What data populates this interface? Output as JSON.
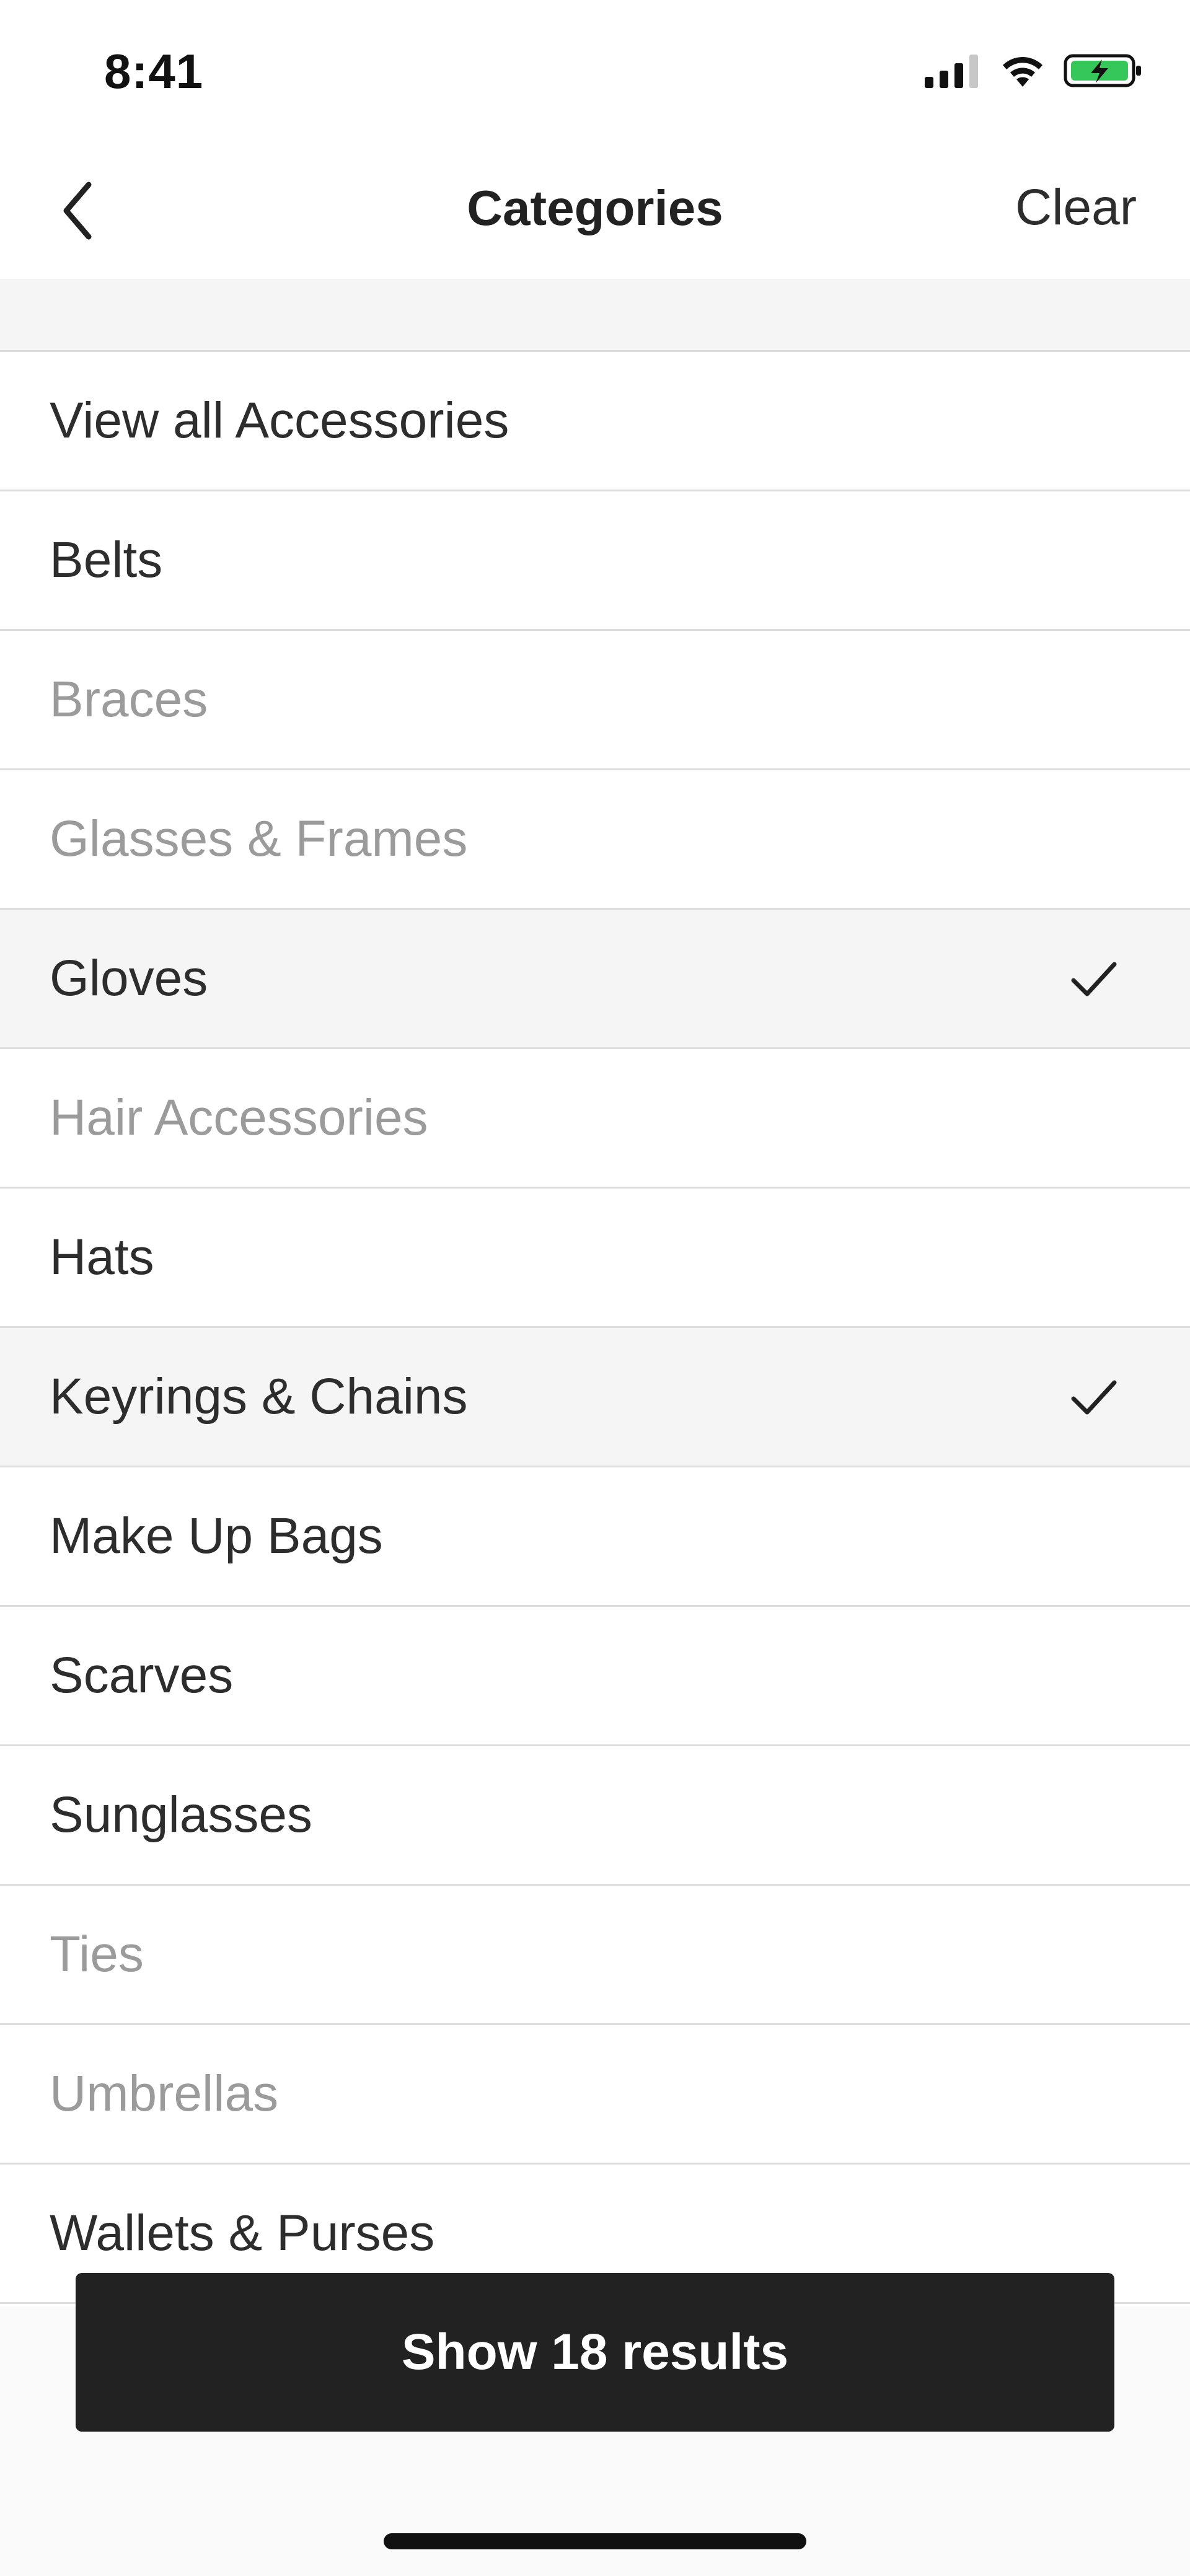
{
  "status_bar": {
    "time": "8:41",
    "icons": [
      "cellular-signal-icon",
      "wifi-icon",
      "battery-charging-icon"
    ],
    "battery_color": "#35c759"
  },
  "nav": {
    "back_icon": "chevron-left-icon",
    "title": "Categories",
    "clear_label": "Clear"
  },
  "categories": [
    {
      "label": "View all Accessories",
      "state": "normal"
    },
    {
      "label": "Belts",
      "state": "normal"
    },
    {
      "label": "Braces",
      "state": "disabled"
    },
    {
      "label": "Glasses & Frames",
      "state": "disabled"
    },
    {
      "label": "Gloves",
      "state": "selected"
    },
    {
      "label": "Hair Accessories",
      "state": "disabled"
    },
    {
      "label": "Hats",
      "state": "normal"
    },
    {
      "label": "Keyrings & Chains",
      "state": "selected"
    },
    {
      "label": "Make Up Bags",
      "state": "normal"
    },
    {
      "label": "Scarves",
      "state": "normal"
    },
    {
      "label": "Sunglasses",
      "state": "normal"
    },
    {
      "label": "Ties",
      "state": "disabled"
    },
    {
      "label": "Umbrellas",
      "state": "disabled"
    },
    {
      "label": "Wallets & Purses",
      "state": "normal"
    }
  ],
  "footer": {
    "show_results_label": "Show 18 results"
  },
  "colors": {
    "primary_text": "#2d2d2d",
    "disabled_text": "#9b9b9b",
    "selected_row_bg": "#f5f5f5",
    "cta_bg": "#222222",
    "cta_text": "#ffffff"
  }
}
